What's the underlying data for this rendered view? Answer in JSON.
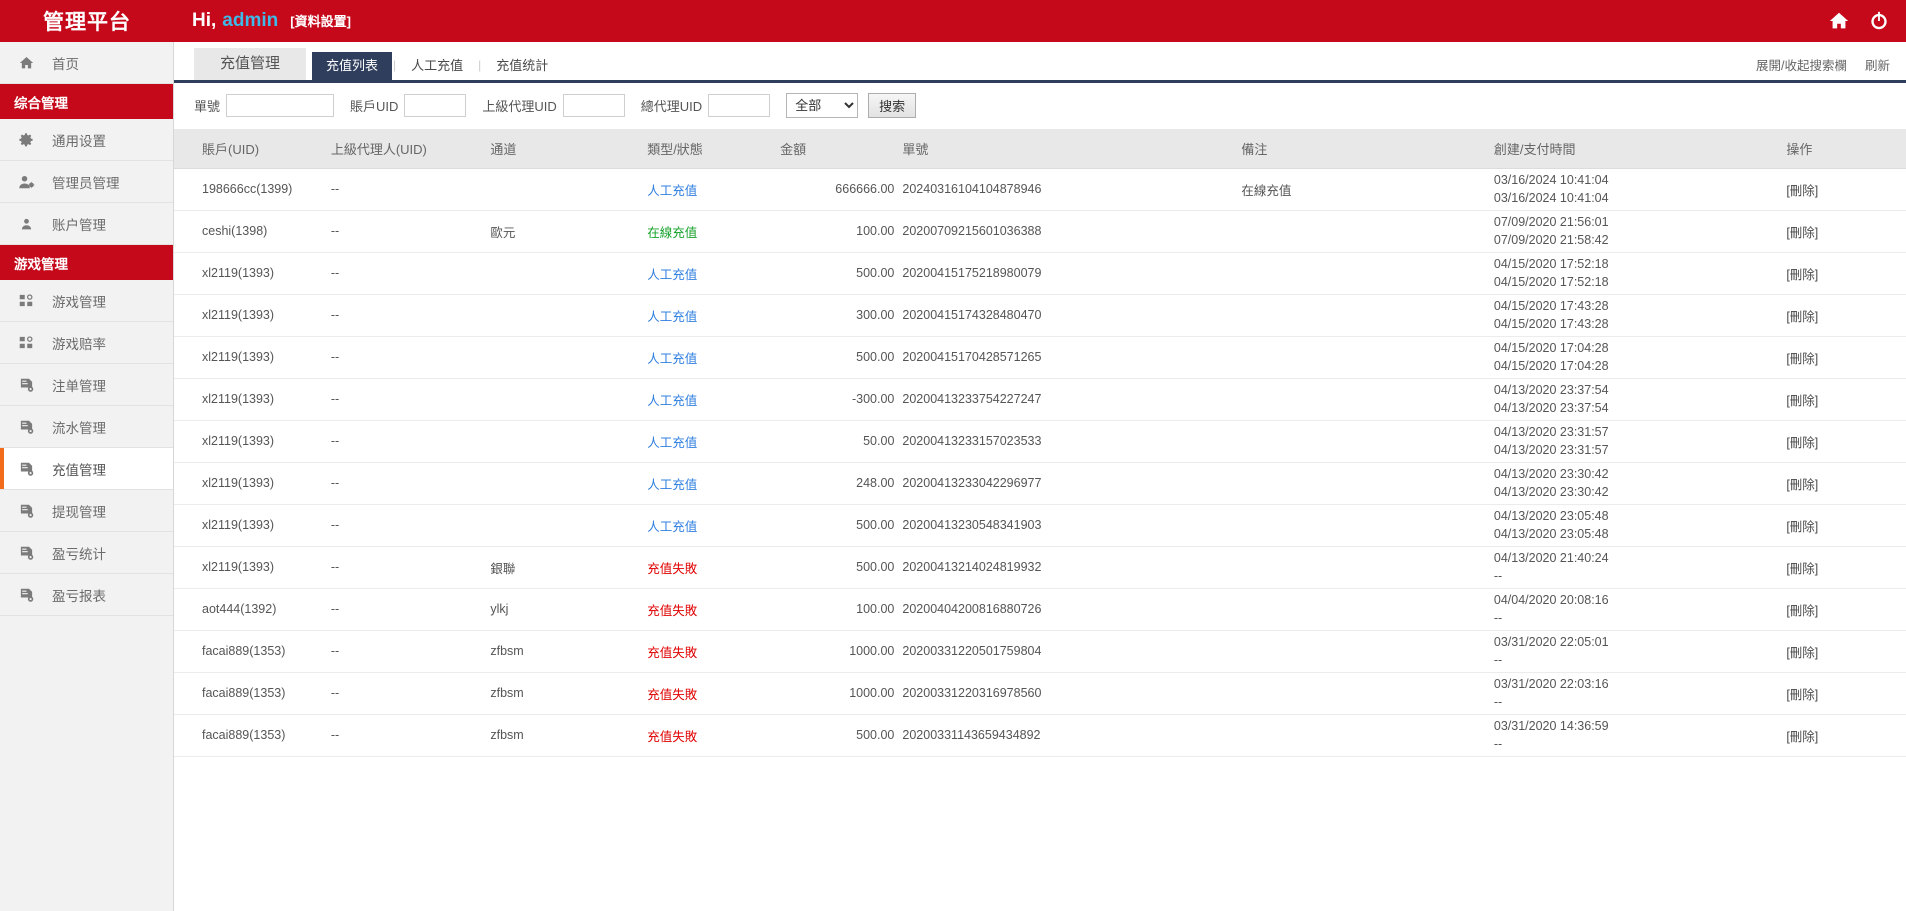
{
  "topbar": {
    "brand": "管理平台",
    "greeting_prefix": "Hi,",
    "admin_name": "admin",
    "profile_link": "[資料設置]",
    "home_icon": "home-icon",
    "power_icon": "power-icon"
  },
  "sidebar": {
    "items": [
      {
        "type": "item",
        "label": "首页",
        "icon": "home-icon",
        "active": false
      },
      {
        "type": "group",
        "label": "综合管理"
      },
      {
        "type": "item",
        "label": "通用设置",
        "icon": "gear-icon",
        "active": false
      },
      {
        "type": "item",
        "label": "管理员管理",
        "icon": "user-gear-icon",
        "active": false
      },
      {
        "type": "item",
        "label": "账户管理",
        "icon": "user-icon",
        "active": false
      },
      {
        "type": "group",
        "label": "游戏管理"
      },
      {
        "type": "item",
        "label": "游戏管理",
        "icon": "grid-icon",
        "active": false
      },
      {
        "type": "item",
        "label": "游戏赔率",
        "icon": "grid-icon",
        "active": false
      },
      {
        "type": "item",
        "label": "注单管理",
        "icon": "report-icon",
        "active": false
      },
      {
        "type": "item",
        "label": "流水管理",
        "icon": "report-icon",
        "active": false
      },
      {
        "type": "item",
        "label": "充值管理",
        "icon": "report-icon",
        "active": true
      },
      {
        "type": "item",
        "label": "提现管理",
        "icon": "report-icon",
        "active": false
      },
      {
        "type": "item",
        "label": "盈亏统计",
        "icon": "report-icon",
        "active": false
      },
      {
        "type": "item",
        "label": "盈亏报表",
        "icon": "report-icon",
        "active": false
      }
    ]
  },
  "tabs": {
    "page_tab": "充值管理",
    "subtabs": [
      {
        "label": "充值列表",
        "active": true
      },
      {
        "label": "人工充值",
        "active": false
      },
      {
        "label": "充值统計",
        "active": false
      }
    ],
    "right_actions": [
      "展開/收起搜索欄",
      "刷新"
    ]
  },
  "search": {
    "fields": [
      {
        "label": "單號",
        "value": "",
        "size": "big"
      },
      {
        "label": "賬戶UID",
        "value": "",
        "size": "small"
      },
      {
        "label": "上級代理UID",
        "value": "",
        "size": "small"
      },
      {
        "label": "總代理UID",
        "value": "",
        "size": "small"
      }
    ],
    "status_selected": "全部",
    "status_options": [
      "全部"
    ],
    "search_button": "搜索"
  },
  "table": {
    "headers": [
      "賬戶(UID)",
      "上級代理人(UID)",
      "通道",
      "類型/狀態",
      "金額",
      "單號",
      "備注",
      "創建/支付時間",
      "操作"
    ],
    "op_label": "[刪除]",
    "rows": [
      {
        "account": "198666cc(1399)",
        "parent": "--",
        "channel": "",
        "type": "人工充值",
        "type_style": "manual",
        "amount": "666666.00",
        "order": "20240316104104878946",
        "remark": "在線充值",
        "created": "03/16/2024 10:41:04",
        "paid": "03/16/2024 10:41:04"
      },
      {
        "account": "ceshi(1398)",
        "parent": "--",
        "channel": "歐元",
        "type": "在線充值",
        "type_style": "online",
        "amount": "100.00",
        "order": "20200709215601036388",
        "remark": "",
        "created": "07/09/2020 21:56:01",
        "paid": "07/09/2020 21:58:42"
      },
      {
        "account": "xl2119(1393)",
        "parent": "--",
        "channel": "",
        "type": "人工充值",
        "type_style": "manual",
        "amount": "500.00",
        "order": "20200415175218980079",
        "remark": "",
        "created": "04/15/2020 17:52:18",
        "paid": "04/15/2020 17:52:18"
      },
      {
        "account": "xl2119(1393)",
        "parent": "--",
        "channel": "",
        "type": "人工充值",
        "type_style": "manual",
        "amount": "300.00",
        "order": "20200415174328480470",
        "remark": "",
        "created": "04/15/2020 17:43:28",
        "paid": "04/15/2020 17:43:28"
      },
      {
        "account": "xl2119(1393)",
        "parent": "--",
        "channel": "",
        "type": "人工充值",
        "type_style": "manual",
        "amount": "500.00",
        "order": "20200415170428571265",
        "remark": "",
        "created": "04/15/2020 17:04:28",
        "paid": "04/15/2020 17:04:28"
      },
      {
        "account": "xl2119(1393)",
        "parent": "--",
        "channel": "",
        "type": "人工充值",
        "type_style": "manual",
        "amount": "-300.00",
        "order": "20200413233754227247",
        "remark": "",
        "created": "04/13/2020 23:37:54",
        "paid": "04/13/2020 23:37:54"
      },
      {
        "account": "xl2119(1393)",
        "parent": "--",
        "channel": "",
        "type": "人工充值",
        "type_style": "manual",
        "amount": "50.00",
        "order": "20200413233157023533",
        "remark": "",
        "created": "04/13/2020 23:31:57",
        "paid": "04/13/2020 23:31:57"
      },
      {
        "account": "xl2119(1393)",
        "parent": "--",
        "channel": "",
        "type": "人工充值",
        "type_style": "manual",
        "amount": "248.00",
        "order": "20200413233042296977",
        "remark": "",
        "created": "04/13/2020 23:30:42",
        "paid": "04/13/2020 23:30:42"
      },
      {
        "account": "xl2119(1393)",
        "parent": "--",
        "channel": "",
        "type": "人工充值",
        "type_style": "manual",
        "amount": "500.00",
        "order": "20200413230548341903",
        "remark": "",
        "created": "04/13/2020 23:05:48",
        "paid": "04/13/2020 23:05:48"
      },
      {
        "account": "xl2119(1393)",
        "parent": "--",
        "channel": "銀聯",
        "type": "充值失敗",
        "type_style": "failed",
        "amount": "500.00",
        "order": "20200413214024819932",
        "remark": "",
        "created": "04/13/2020 21:40:24",
        "paid": "--"
      },
      {
        "account": "aot444(1392)",
        "parent": "--",
        "channel": "ylkj",
        "type": "充值失敗",
        "type_style": "failed",
        "amount": "100.00",
        "order": "20200404200816880726",
        "remark": "",
        "created": "04/04/2020 20:08:16",
        "paid": "--"
      },
      {
        "account": "facai889(1353)",
        "parent": "--",
        "channel": "zfbsm",
        "type": "充值失敗",
        "type_style": "failed",
        "amount": "1000.00",
        "order": "20200331220501759804",
        "remark": "",
        "created": "03/31/2020 22:05:01",
        "paid": "--"
      },
      {
        "account": "facai889(1353)",
        "parent": "--",
        "channel": "zfbsm",
        "type": "充值失敗",
        "type_style": "failed",
        "amount": "1000.00",
        "order": "20200331220316978560",
        "remark": "",
        "created": "03/31/2020 22:03:16",
        "paid": "--"
      },
      {
        "account": "facai889(1353)",
        "parent": "--",
        "channel": "zfbsm",
        "type": "充值失敗",
        "type_style": "failed",
        "amount": "500.00",
        "order": "20200331143659434892",
        "remark": "",
        "created": "03/31/2020 14:36:59",
        "paid": "--"
      }
    ]
  },
  "colors": {
    "brand_red": "#c5081a",
    "tab_navy": "#2e3e5c",
    "active_orange": "#f26c1c",
    "link_blue": "#2f7fe0",
    "success_green": "#17a32b",
    "error_red": "#e00000",
    "admin_cyan": "#3fb9e8"
  }
}
